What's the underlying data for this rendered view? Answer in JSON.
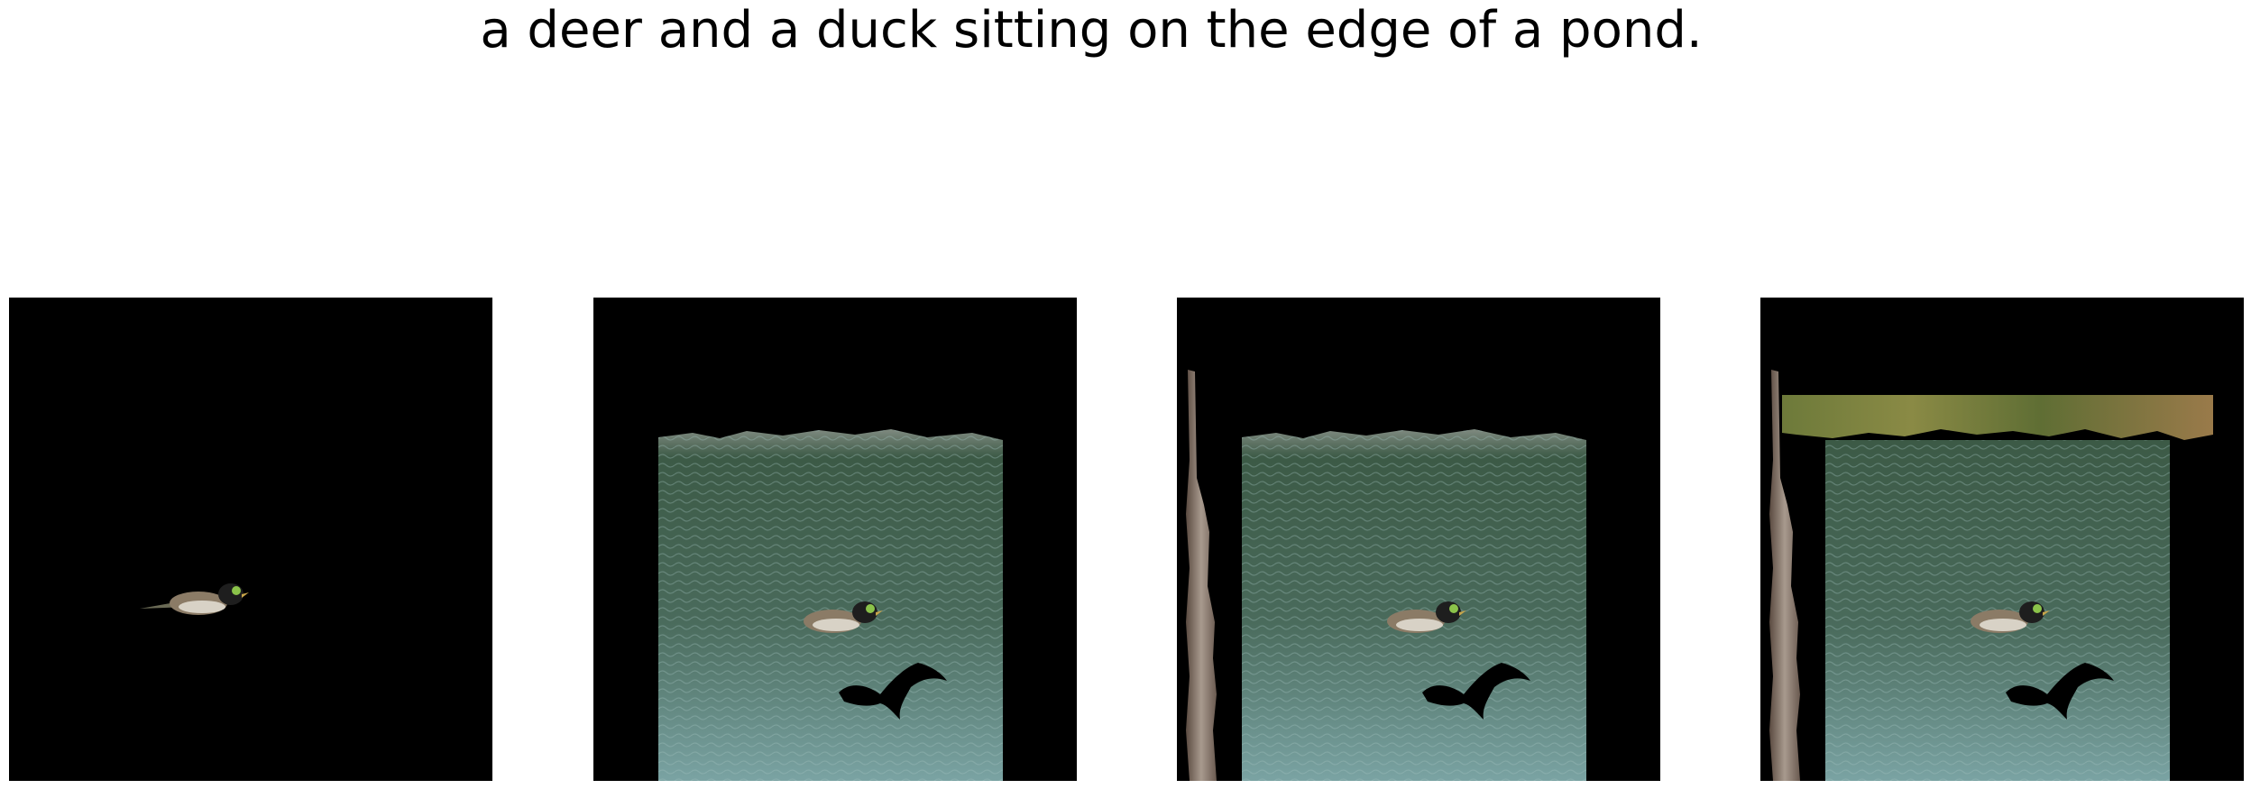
{
  "caption": "a deer and a duck sitting on the edge of a pond.",
  "panels": [
    {
      "id": "panel-1",
      "content": [
        "duck"
      ]
    },
    {
      "id": "panel-2",
      "content": [
        "duck",
        "pond-water",
        "bird-silhouette"
      ]
    },
    {
      "id": "panel-3",
      "content": [
        "duck",
        "pond-water",
        "bird-silhouette",
        "tree-trunk"
      ]
    },
    {
      "id": "panel-4",
      "content": [
        "duck",
        "pond-water",
        "bird-silhouette",
        "tree-trunk",
        "shoreline-vegetation"
      ]
    }
  ],
  "colors": {
    "background": "#000000",
    "water_dark": "#3f5a45",
    "water_light": "#6f9a98",
    "vegetation": "#7a7a3a",
    "trunk": "#8a7a6e"
  }
}
